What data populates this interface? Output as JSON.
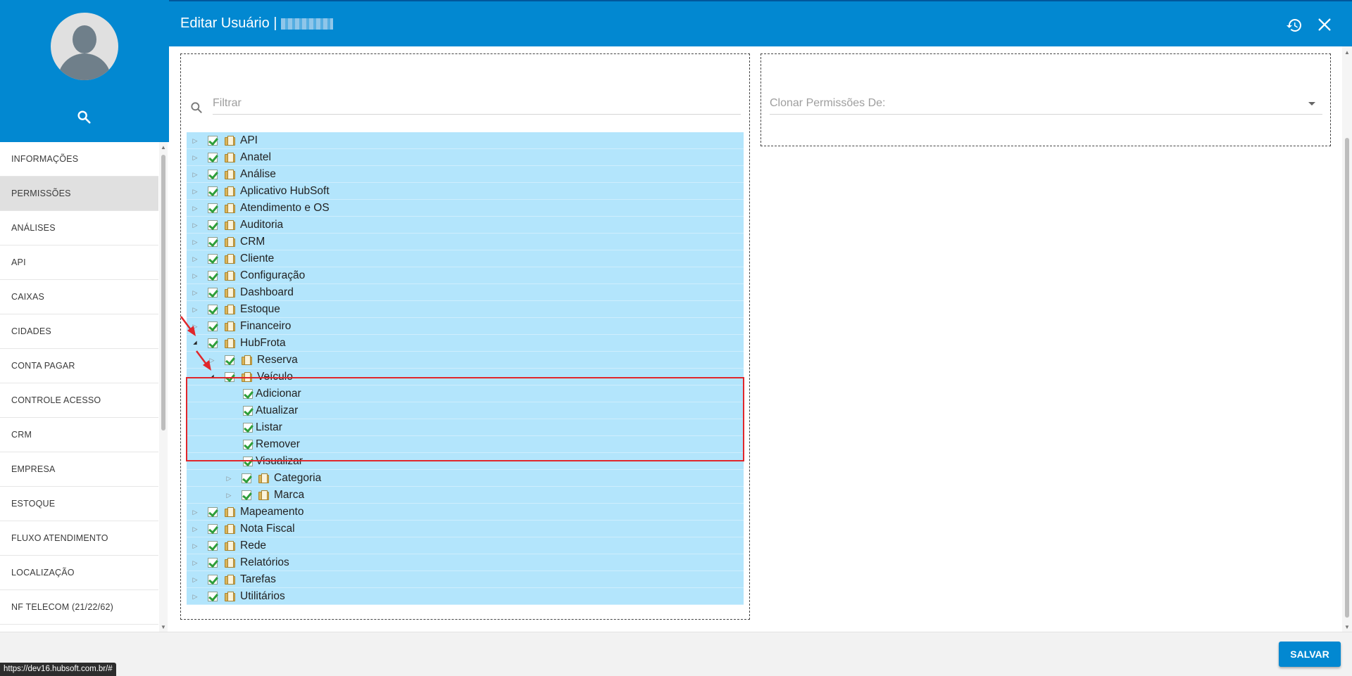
{
  "window": {
    "title": "Editar Usuário |",
    "title_redacted": true
  },
  "sidebar": {
    "search_icon": "search-icon",
    "items": [
      {
        "label": "INFORMAÇÕES",
        "active": false
      },
      {
        "label": "PERMISSÕES",
        "active": true
      },
      {
        "label": "ANÁLISES",
        "active": false
      },
      {
        "label": "API",
        "active": false
      },
      {
        "label": "CAIXAS",
        "active": false
      },
      {
        "label": "CIDADES",
        "active": false
      },
      {
        "label": "CONTA PAGAR",
        "active": false
      },
      {
        "label": "CONTROLE ACESSO",
        "active": false
      },
      {
        "label": "CRM",
        "active": false
      },
      {
        "label": "EMPRESA",
        "active": false
      },
      {
        "label": "ESTOQUE",
        "active": false
      },
      {
        "label": "FLUXO ATENDIMENTO",
        "active": false
      },
      {
        "label": "LOCALIZAÇÃO",
        "active": false
      },
      {
        "label": "NF TELECOM (21/22/62)",
        "active": false
      }
    ]
  },
  "permissions": {
    "filter_placeholder": "Filtrar",
    "clone_placeholder": "Clonar Permissões De:",
    "tree": [
      {
        "label": "API",
        "level": 0,
        "expanded": false,
        "folder": true,
        "checked": true
      },
      {
        "label": "Anatel",
        "level": 0,
        "expanded": false,
        "folder": true,
        "checked": true
      },
      {
        "label": "Análise",
        "level": 0,
        "expanded": false,
        "folder": true,
        "checked": true
      },
      {
        "label": "Aplicativo HubSoft",
        "level": 0,
        "expanded": false,
        "folder": true,
        "checked": true
      },
      {
        "label": "Atendimento e OS",
        "level": 0,
        "expanded": false,
        "folder": true,
        "checked": true
      },
      {
        "label": "Auditoria",
        "level": 0,
        "expanded": false,
        "folder": true,
        "checked": true
      },
      {
        "label": "CRM",
        "level": 0,
        "expanded": false,
        "folder": true,
        "checked": true
      },
      {
        "label": "Cliente",
        "level": 0,
        "expanded": false,
        "folder": true,
        "checked": true
      },
      {
        "label": "Configuração",
        "level": 0,
        "expanded": false,
        "folder": true,
        "checked": true
      },
      {
        "label": "Dashboard",
        "level": 0,
        "expanded": false,
        "folder": true,
        "checked": true
      },
      {
        "label": "Estoque",
        "level": 0,
        "expanded": false,
        "folder": true,
        "checked": true
      },
      {
        "label": "Financeiro",
        "level": 0,
        "expanded": false,
        "folder": true,
        "checked": true
      },
      {
        "label": "HubFrota",
        "level": 0,
        "expanded": true,
        "folder": true,
        "checked": true
      },
      {
        "label": "Reserva",
        "level": 1,
        "expanded": false,
        "folder": true,
        "checked": true
      },
      {
        "label": "Veículo",
        "level": 1,
        "expanded": true,
        "folder": true,
        "checked": true
      },
      {
        "label": "Adicionar",
        "level": 2,
        "expanded": null,
        "folder": false,
        "checked": true
      },
      {
        "label": "Atualizar",
        "level": 2,
        "expanded": null,
        "folder": false,
        "checked": true
      },
      {
        "label": "Listar",
        "level": 2,
        "expanded": null,
        "folder": false,
        "checked": true
      },
      {
        "label": "Remover",
        "level": 2,
        "expanded": null,
        "folder": false,
        "checked": true
      },
      {
        "label": "Visualizar",
        "level": 2,
        "expanded": null,
        "folder": false,
        "checked": true
      },
      {
        "label": "Categoria",
        "level": 2,
        "expanded": false,
        "folder": true,
        "checked": true
      },
      {
        "label": "Marca",
        "level": 2,
        "expanded": false,
        "folder": true,
        "checked": true
      },
      {
        "label": "Mapeamento",
        "level": 0,
        "expanded": false,
        "folder": true,
        "checked": true
      },
      {
        "label": "Nota Fiscal",
        "level": 0,
        "expanded": false,
        "folder": true,
        "checked": true
      },
      {
        "label": "Rede",
        "level": 0,
        "expanded": false,
        "folder": true,
        "checked": true
      },
      {
        "label": "Relatórios",
        "level": 0,
        "expanded": false,
        "folder": true,
        "checked": true
      },
      {
        "label": "Tarefas",
        "level": 0,
        "expanded": false,
        "folder": true,
        "checked": true
      },
      {
        "label": "Utilitários",
        "level": 0,
        "expanded": false,
        "folder": true,
        "checked": true
      }
    ]
  },
  "footer": {
    "save_label": "SALVAR",
    "status_url": "https://dev16.hubsoft.com.br/#"
  },
  "colors": {
    "primary": "#0288d1",
    "tree_row": "#b3e5fc",
    "annotation_red": "#e0262b",
    "check_green": "#2e9e3a"
  }
}
